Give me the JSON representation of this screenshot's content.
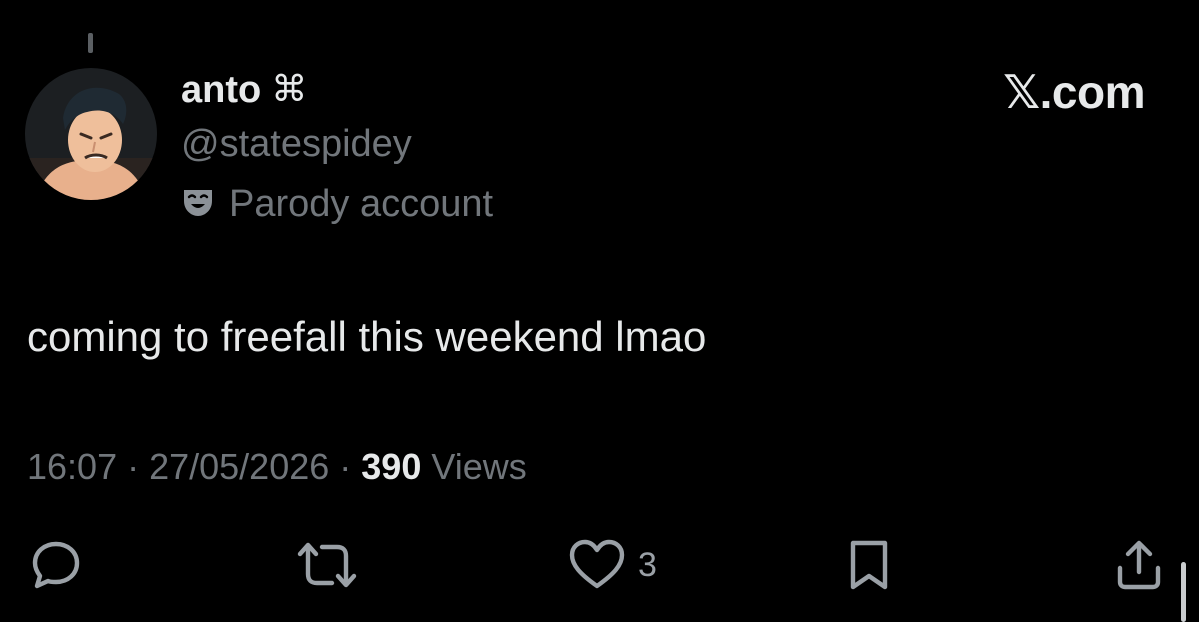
{
  "tweet": {
    "author": {
      "display_name": "anto",
      "name_emoji": "⌘",
      "handle": "@statespidey",
      "label": "Parody account",
      "label_icon": "theater-mask-icon"
    },
    "brand": "𝕏.com",
    "text": "coming to freefall this weekend lmao",
    "meta": {
      "time": "16:07",
      "separator": " · ",
      "date": "27/05/2026",
      "views_count": "390",
      "views_label": " Views"
    },
    "actions": {
      "reply_icon": "reply-bubble-icon",
      "retweet_icon": "retweet-icon",
      "like_icon": "heart-icon",
      "like_count": "3",
      "bookmark_icon": "bookmark-icon",
      "share_icon": "share-icon"
    }
  }
}
